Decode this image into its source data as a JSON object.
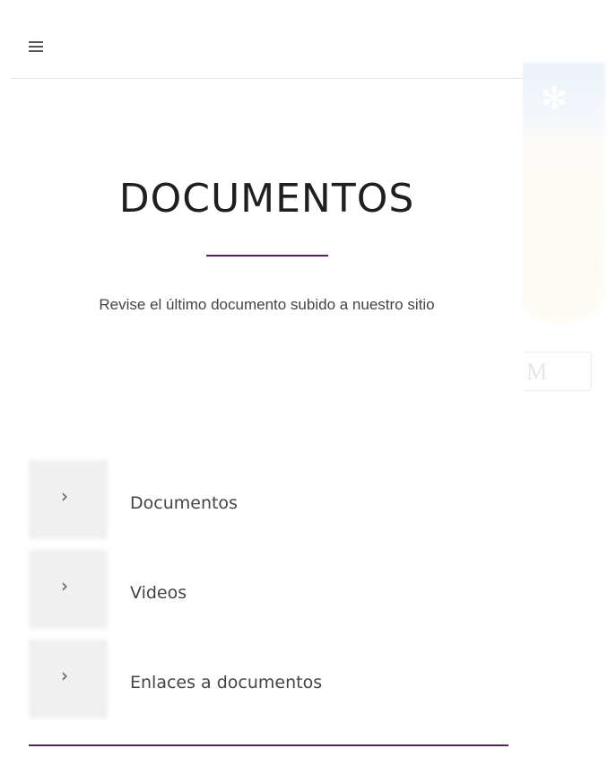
{
  "header": {
    "menu_icon": "hamburger-icon"
  },
  "main": {
    "title": "DOCUMENTOS",
    "subtitle": "Revise el último documento subido a nuestro sitio",
    "accent_color": "#5a2167"
  },
  "menu": {
    "chevron_icon": "chevron-right-icon",
    "items": [
      {
        "label": "Documentos"
      },
      {
        "label": "Videos"
      },
      {
        "label": "Enlaces a documentos"
      }
    ]
  },
  "background": {
    "badge_text": "M"
  }
}
